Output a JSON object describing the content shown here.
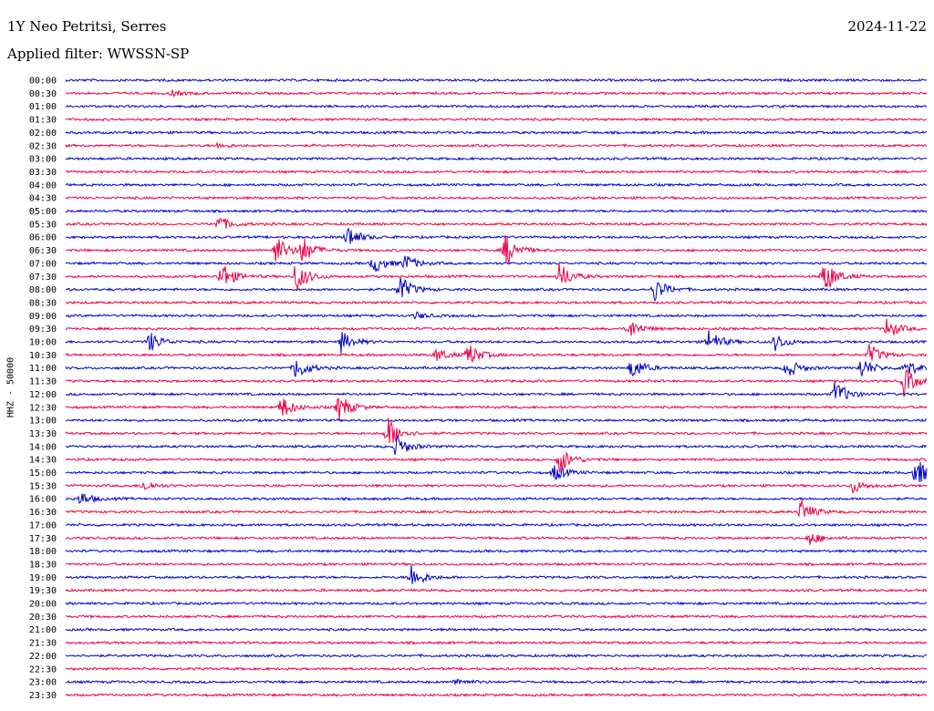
{
  "header": {
    "station": "1Y Neo Petritsi, Serres",
    "date": "2024-11-22",
    "filter": "Applied filter: WWSSN-SP",
    "channel_label": "HHZ - 50000"
  },
  "colors": {
    "even": "#0000cc",
    "odd": "#ee0044",
    "background": "#ffffff"
  },
  "chart_data": {
    "type": "helicorder",
    "ylabel": "HHZ - 50000",
    "row_labels": [
      "00:00",
      "00:30",
      "01:00",
      "01:30",
      "02:00",
      "02:30",
      "03:00",
      "03:30",
      "04:00",
      "04:30",
      "05:00",
      "05:30",
      "06:00",
      "06:30",
      "07:00",
      "07:30",
      "08:00",
      "08:30",
      "09:00",
      "09:30",
      "10:00",
      "10:30",
      "11:00",
      "11:30",
      "12:00",
      "12:30",
      "13:00",
      "13:30",
      "14:00",
      "14:30",
      "15:00",
      "15:30",
      "16:00",
      "16:30",
      "17:00",
      "17:30",
      "18:00",
      "18:30",
      "19:00",
      "19:30",
      "20:00",
      "20:30",
      "21:00",
      "21:30",
      "22:00",
      "22:30",
      "23:00",
      "23:30"
    ],
    "minutes_per_row": 30,
    "events": [
      {
        "row": 1,
        "minute": 3.7,
        "amp": 3
      },
      {
        "row": 5,
        "minute": 5.3,
        "amp": 3
      },
      {
        "row": 11,
        "minute": 5.3,
        "amp": 10
      },
      {
        "row": 12,
        "minute": 9.8,
        "amp": 14
      },
      {
        "row": 13,
        "minute": 7.3,
        "amp": 18
      },
      {
        "row": 13,
        "minute": 8.2,
        "amp": 16
      },
      {
        "row": 13,
        "minute": 15.3,
        "amp": 20
      },
      {
        "row": 14,
        "minute": 10.7,
        "amp": 12
      },
      {
        "row": 14,
        "minute": 11.8,
        "amp": 10
      },
      {
        "row": 15,
        "minute": 5.4,
        "amp": 18
      },
      {
        "row": 15,
        "minute": 8.0,
        "amp": 18
      },
      {
        "row": 15,
        "minute": 17.2,
        "amp": 16
      },
      {
        "row": 15,
        "minute": 26.4,
        "amp": 22
      },
      {
        "row": 16,
        "minute": 11.6,
        "amp": 18
      },
      {
        "row": 16,
        "minute": 20.5,
        "amp": 14
      },
      {
        "row": 18,
        "minute": 12.2,
        "amp": 4
      },
      {
        "row": 19,
        "minute": 19.6,
        "amp": 12
      },
      {
        "row": 19,
        "minute": 28.6,
        "amp": 12
      },
      {
        "row": 20,
        "minute": 2.9,
        "amp": 12
      },
      {
        "row": 20,
        "minute": 9.6,
        "amp": 12
      },
      {
        "row": 20,
        "minute": 22.4,
        "amp": 14
      },
      {
        "row": 20,
        "minute": 24.7,
        "amp": 10
      },
      {
        "row": 21,
        "minute": 12.9,
        "amp": 8
      },
      {
        "row": 21,
        "minute": 14.0,
        "amp": 14
      },
      {
        "row": 21,
        "minute": 28.0,
        "amp": 12
      },
      {
        "row": 22,
        "minute": 8.0,
        "amp": 14
      },
      {
        "row": 22,
        "minute": 19.7,
        "amp": 14
      },
      {
        "row": 22,
        "minute": 25.1,
        "amp": 12
      },
      {
        "row": 22,
        "minute": 27.7,
        "amp": 12
      },
      {
        "row": 22,
        "minute": 29.2,
        "amp": 12
      },
      {
        "row": 23,
        "minute": 29.2,
        "amp": 16
      },
      {
        "row": 24,
        "minute": 26.8,
        "amp": 16
      },
      {
        "row": 25,
        "minute": 7.5,
        "amp": 14
      },
      {
        "row": 25,
        "minute": 9.5,
        "amp": 16
      },
      {
        "row": 27,
        "minute": 11.2,
        "amp": 20
      },
      {
        "row": 28,
        "minute": 11.5,
        "amp": 14
      },
      {
        "row": 29,
        "minute": 17.2,
        "amp": 16
      },
      {
        "row": 30,
        "minute": 17.0,
        "amp": 10
      },
      {
        "row": 30,
        "minute": 29.6,
        "amp": 18
      },
      {
        "row": 31,
        "minute": 2.7,
        "amp": 6
      },
      {
        "row": 31,
        "minute": 27.4,
        "amp": 8
      },
      {
        "row": 32,
        "minute": 0.5,
        "amp": 8
      },
      {
        "row": 33,
        "minute": 25.6,
        "amp": 14
      },
      {
        "row": 35,
        "minute": 25.9,
        "amp": 8
      },
      {
        "row": 38,
        "minute": 12.0,
        "amp": 16
      },
      {
        "row": 46,
        "minute": 13.6,
        "amp": 4
      }
    ]
  }
}
